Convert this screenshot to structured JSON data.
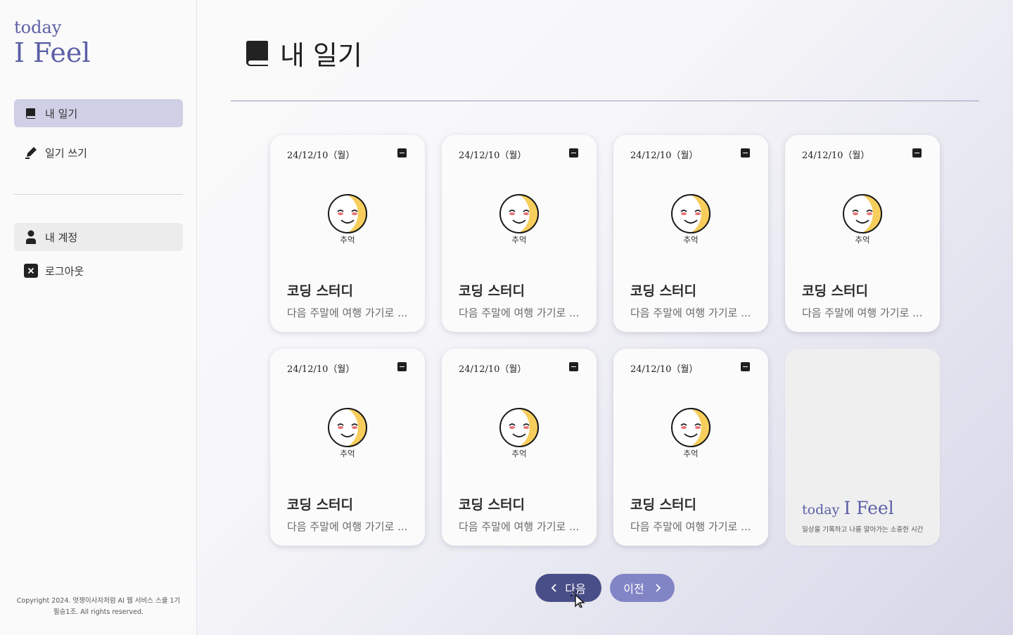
{
  "sidebar": {
    "logo_small": "today",
    "logo_big": "I Feel",
    "nav": [
      {
        "label": "내 일기",
        "icon": "book-icon"
      },
      {
        "label": "일기 쓰기",
        "icon": "pen-icon"
      }
    ],
    "account": [
      {
        "label": "내 계정",
        "icon": "user-icon"
      },
      {
        "label": "로그아웃",
        "icon": "close-box-icon"
      }
    ],
    "copyright_line1": "Copyright 2024. 멋쟁이사자처럼 AI 웹 서비스 스쿨 1기",
    "copyright_line2": "필승1조. All rights reserved."
  },
  "header": {
    "title": "내 일기",
    "icon": "book-icon"
  },
  "cards": [
    {
      "date": "24/12/10（월）",
      "emotion": "추억",
      "title": "코딩 스터디",
      "body": "다음 주말에 여행 가기로 ..."
    },
    {
      "date": "24/12/10（월）",
      "emotion": "추억",
      "title": "코딩 스터디",
      "body": "다음 주말에 여행 가기로 ..."
    },
    {
      "date": "24/12/10（월）",
      "emotion": "추억",
      "title": "코딩 스터디",
      "body": "다음 주말에 여행 가기로 ..."
    },
    {
      "date": "24/12/10（월）",
      "emotion": "추억",
      "title": "코딩 스터디",
      "body": "다음 주말에 여행 가기로 ..."
    },
    {
      "date": "24/12/10（월）",
      "emotion": "추억",
      "title": "코딩 스터디",
      "body": "다음 주말에 여행 가기로 ..."
    },
    {
      "date": "24/12/10（월）",
      "emotion": "추억",
      "title": "코딩 스터디",
      "body": "다음 주말에 여행 가기로 ..."
    },
    {
      "date": "24/12/10（월）",
      "emotion": "추억",
      "title": "코딩 스터디",
      "body": "다음 주말에 여행 가기로 ..."
    }
  ],
  "brand_card": {
    "small": "today",
    "big": "I Feel",
    "tagline": "일상을 기록하고 나를 알아가는 소중한 시간"
  },
  "pagination": {
    "next_label": "다음",
    "prev_label": "이전"
  },
  "colors": {
    "accent": "#5b5fa6",
    "nav_active": "#cfcfe6",
    "next_button": "#4a4e88",
    "prev_button": "#8285c5",
    "emotion_yellow": "#f6c94a"
  }
}
